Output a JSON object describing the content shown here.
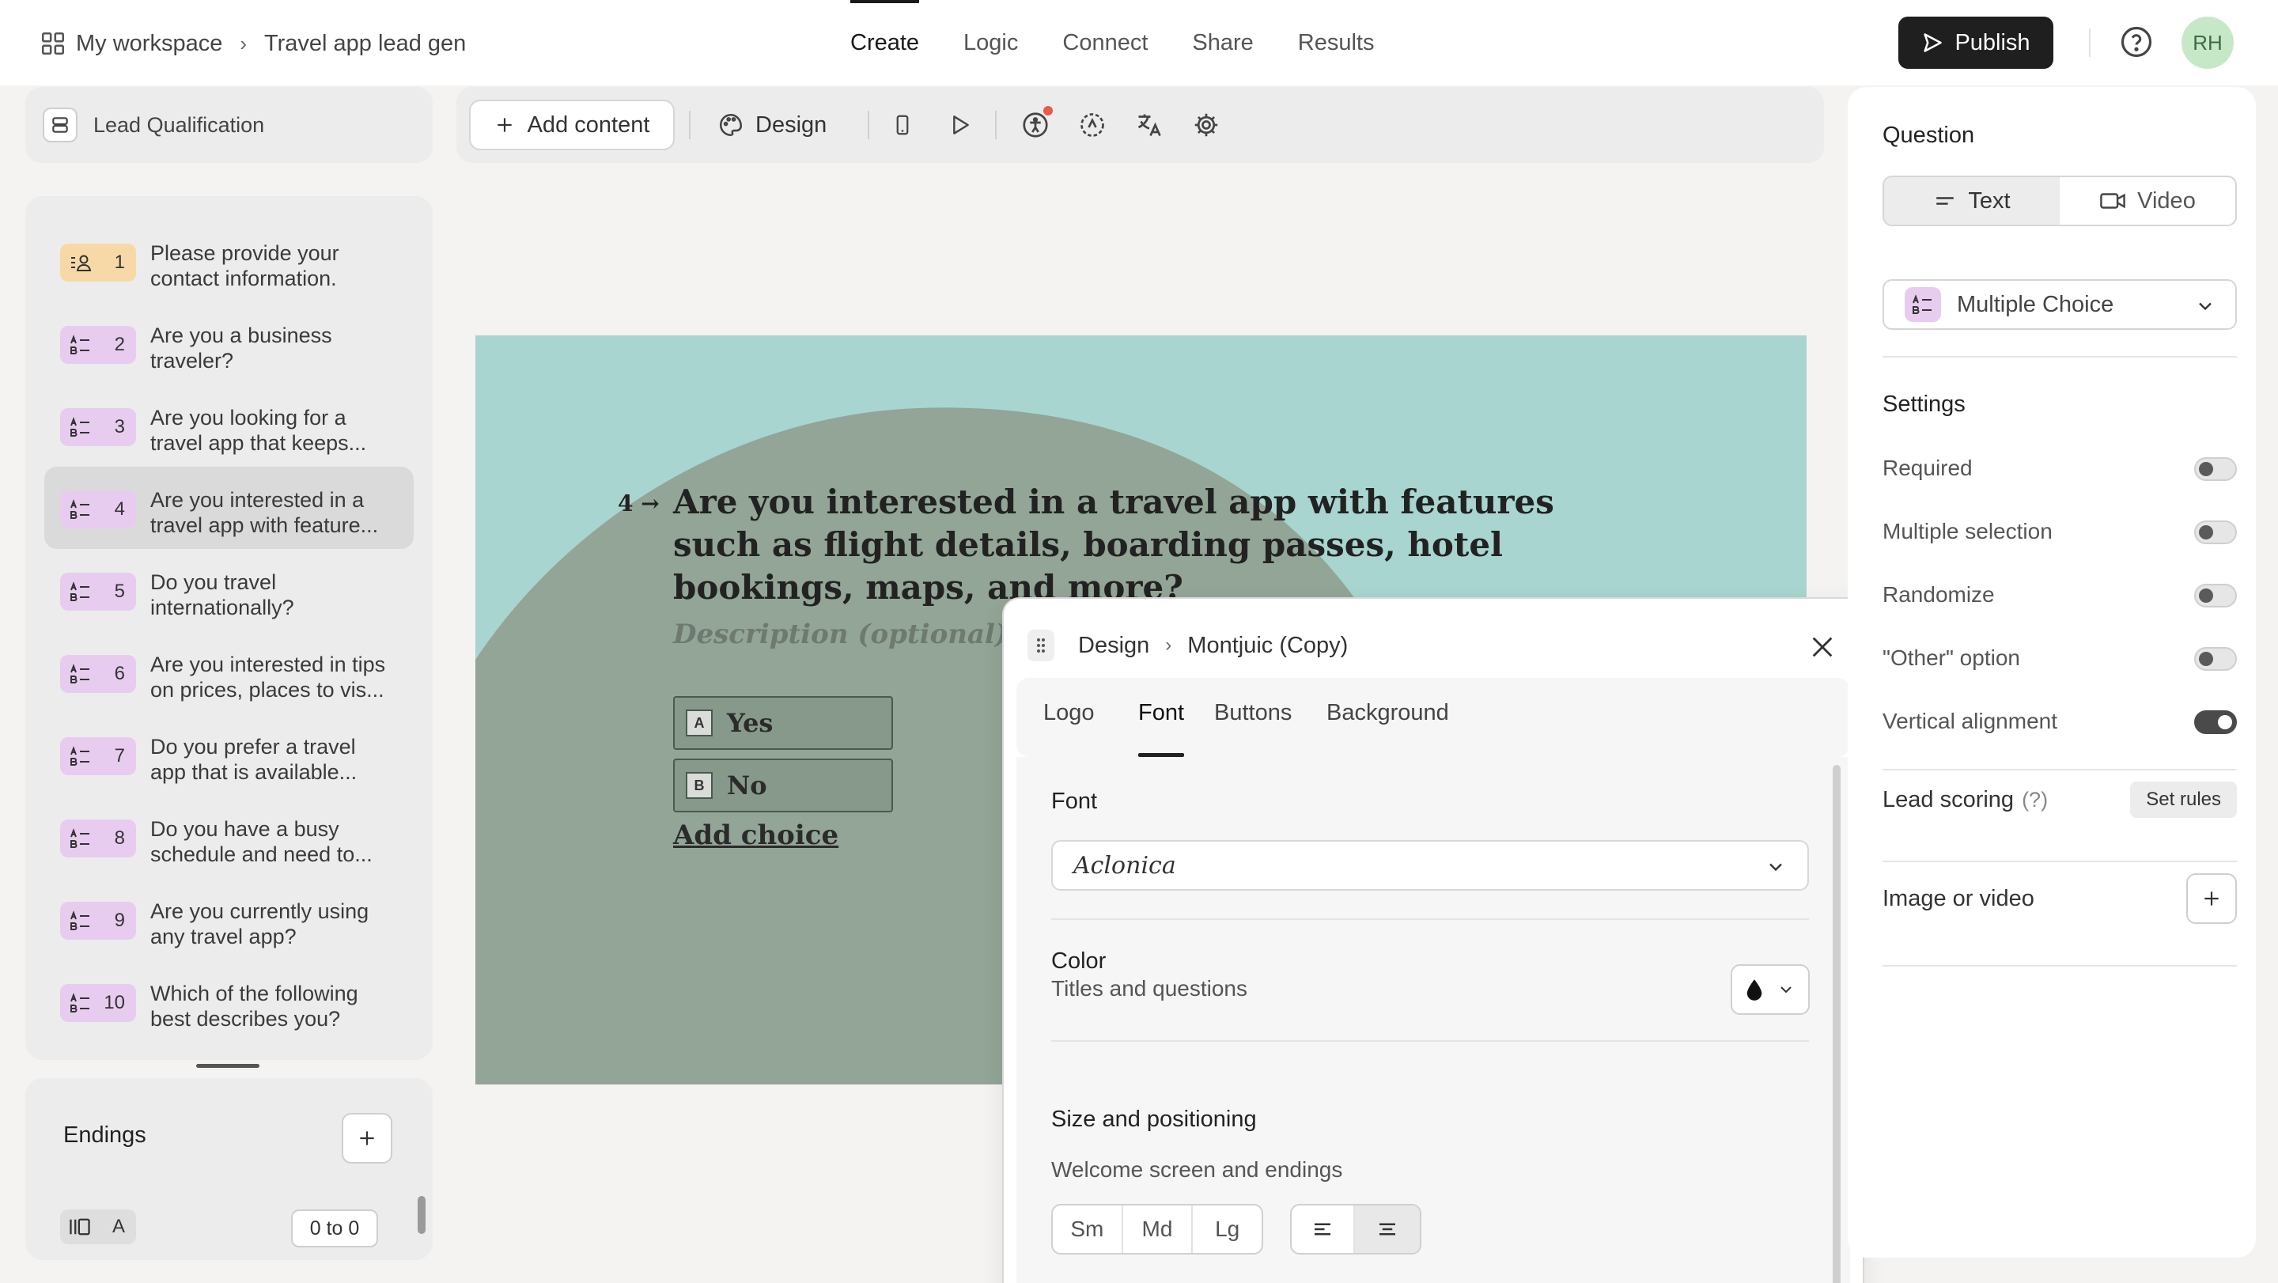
{
  "breadcrumb": {
    "workspace": "My workspace",
    "form": "Travel app lead gen"
  },
  "nav": {
    "tabs": [
      "Create",
      "Logic",
      "Connect",
      "Share",
      "Results"
    ],
    "active": "Create"
  },
  "header": {
    "publish_label": "Publish",
    "avatar_initials": "RH"
  },
  "left": {
    "form_title": "Lead Qualification",
    "questions": [
      {
        "num": "1",
        "text": "Please provide your contact information.",
        "type": "contact"
      },
      {
        "num": "2",
        "text": "Are you a business traveler?",
        "type": "multiple-choice"
      },
      {
        "num": "3",
        "text": "Are you looking for a travel app that keeps...",
        "type": "multiple-choice"
      },
      {
        "num": "4",
        "text": "Are you interested in a travel app with feature...",
        "type": "multiple-choice",
        "active": true
      },
      {
        "num": "5",
        "text": "Do you travel internationally?",
        "type": "multiple-choice"
      },
      {
        "num": "6",
        "text": "Are you interested in tips on prices, places to vis...",
        "type": "multiple-choice"
      },
      {
        "num": "7",
        "text": "Do you prefer a travel app that is available...",
        "type": "multiple-choice"
      },
      {
        "num": "8",
        "text": "Do you have a busy schedule and need to...",
        "type": "multiple-choice"
      },
      {
        "num": "9",
        "text": "Are you currently using any travel app?",
        "type": "multiple-choice"
      },
      {
        "num": "10",
        "text": "Which of the following best describes you?",
        "type": "multiple-choice"
      }
    ],
    "endings": {
      "title": "Endings",
      "item_letter": "A",
      "item_range": "0 to 0"
    }
  },
  "toolbar": {
    "add_content": "Add content",
    "design": "Design"
  },
  "canvas": {
    "question_number": "4",
    "question_title": "Are you interested in a travel app with features such as flight details, boarding passes, hotel bookings, maps, and more?",
    "description_placeholder": "Description (optional)",
    "choices": [
      {
        "key": "A",
        "text": "Yes"
      },
      {
        "key": "B",
        "text": "No"
      }
    ],
    "add_choice": "Add choice",
    "colors": {
      "background": "#a8d5cf",
      "blob": "#92a596"
    }
  },
  "design_popup": {
    "breadcrumb_root": "Design",
    "breadcrumb_theme": "Montjuic (Copy)",
    "tabs": [
      "Logo",
      "Font",
      "Buttons",
      "Background"
    ],
    "active_tab": "Font",
    "font_label": "Font",
    "font_value": "Aclonica",
    "color_label": "Color",
    "color_row_label": "Titles and questions",
    "size_label": "Size and positioning",
    "size_sub": "Welcome screen and endings",
    "sizes": [
      "Sm",
      "Md",
      "Lg"
    ]
  },
  "right": {
    "question_heading": "Question",
    "content_types": [
      "Text",
      "Video"
    ],
    "question_type": "Multiple Choice",
    "settings_heading": "Settings",
    "settings": [
      {
        "label": "Required",
        "on": false
      },
      {
        "label": "Multiple selection",
        "on": false
      },
      {
        "label": "Randomize",
        "on": false
      },
      {
        "label": "\"Other\" option",
        "on": false
      },
      {
        "label": "Vertical alignment",
        "on": true
      }
    ],
    "lead_scoring": "Lead scoring",
    "lead_scoring_hint": "(?)",
    "set_rules": "Set rules",
    "image_or_video": "Image or video"
  }
}
